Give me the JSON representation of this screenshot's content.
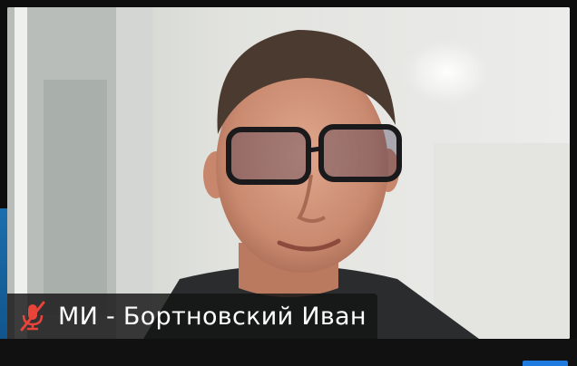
{
  "participant": {
    "name": "МИ - Бортновский Иван",
    "mic_icon": "mic-muted-icon"
  },
  "colors": {
    "muted_indicator": "#e8443a",
    "label_background": "#141414",
    "accent": "#1f7be0"
  }
}
